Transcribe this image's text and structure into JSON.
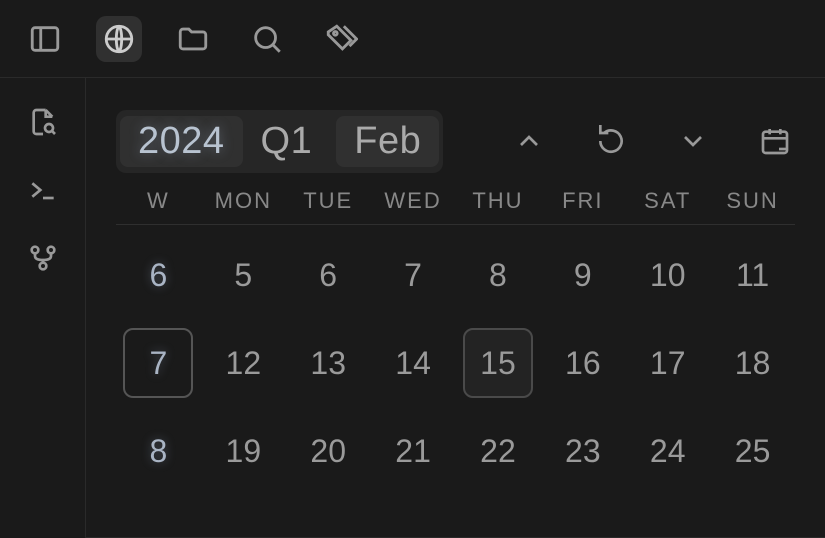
{
  "topbar": {
    "icons": [
      "sidebar",
      "globe",
      "folder",
      "search",
      "tag"
    ],
    "active": "globe"
  },
  "leftrail": {
    "icons": [
      "file-search",
      "terminal",
      "fork"
    ]
  },
  "header": {
    "year": "2024",
    "quarter": "Q1",
    "month": "Feb"
  },
  "calendar": {
    "week_label": "W",
    "dow": [
      "MON",
      "TUE",
      "WED",
      "THU",
      "FRI",
      "SAT",
      "SUN"
    ],
    "rows": [
      {
        "week": "6",
        "days": [
          "5",
          "6",
          "7",
          "8",
          "9",
          "10",
          "11"
        ],
        "selected_week": false,
        "selected_day_index": -1
      },
      {
        "week": "7",
        "days": [
          "12",
          "13",
          "14",
          "15",
          "16",
          "17",
          "18"
        ],
        "selected_week": true,
        "selected_day_index": 3
      },
      {
        "week": "8",
        "days": [
          "19",
          "20",
          "21",
          "22",
          "23",
          "24",
          "25"
        ],
        "selected_week": false,
        "selected_day_index": -1
      }
    ]
  }
}
